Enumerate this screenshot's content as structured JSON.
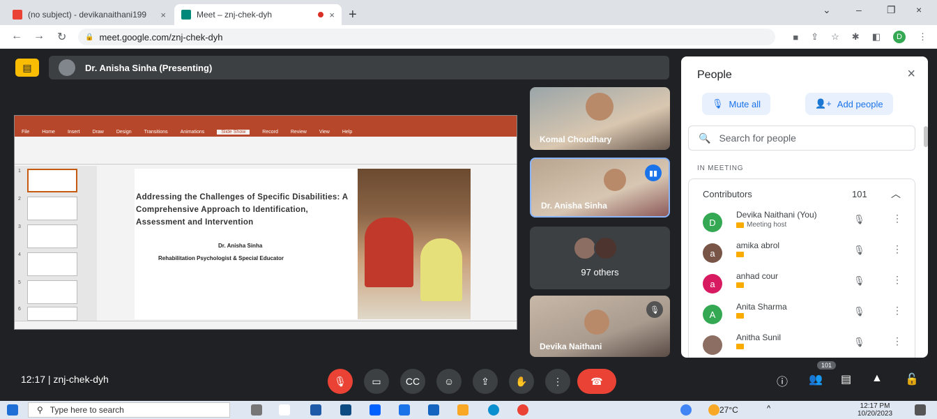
{
  "browser": {
    "tabs": [
      {
        "title": "(no subject) - devikanaithani199",
        "close": "×"
      },
      {
        "title": "Meet – znj-chek-dyh",
        "close": "×"
      }
    ],
    "new_tab": "+",
    "window_controls": {
      "chevron": "⌄",
      "minimize": "–",
      "restore": "❐",
      "close": "×"
    },
    "url": "meet.google.com/znj-chek-dyh",
    "profile_letter": "D",
    "accent": "#1a73e8"
  },
  "meet": {
    "presenter_label": "Dr. Anisha Sinha (Presenting)",
    "slide": {
      "heading": "Addressing the Challenges of Specific Disabilities: A Comprehensive Approach to Identification, Assessment and Intervention",
      "author": "Dr. Anisha Sinha",
      "role": "Rehabilitation Psychologist & Special Educator",
      "ppt_tabs": [
        "File",
        "Home",
        "Insert",
        "Draw",
        "Design",
        "Transitions",
        "Animations",
        "Slide Show",
        "Record",
        "Review",
        "View",
        "Help"
      ],
      "thumb_numbers": [
        "1",
        "2",
        "3",
        "4",
        "5",
        "6"
      ]
    },
    "tiles": [
      {
        "name": "Komal Choudhary"
      },
      {
        "name": "Dr. Anisha Sinha"
      },
      {
        "name": "97 others"
      },
      {
        "name": "Devika Naithani"
      }
    ],
    "meeting_code": "12:17  |  znj-chek-dyh",
    "people_count_badge": "101"
  },
  "people_panel": {
    "title": "People",
    "close_icon": "×",
    "mute_all": "Mute all",
    "add_people": "Add people",
    "search_placeholder": "Search for people",
    "in_meeting": "IN MEETING",
    "contributors_label": "Contributors",
    "contributors_count": "101",
    "participants": [
      {
        "name": "Devika Naithani (You)",
        "sub": "Meeting host",
        "initial": "D",
        "color": "#34a853"
      },
      {
        "name": "amika abrol",
        "sub": "",
        "initial": "a",
        "color": "#795548"
      },
      {
        "name": "anhad cour",
        "sub": "",
        "initial": "a",
        "color": "#d81b60"
      },
      {
        "name": "Anita Sharma",
        "sub": "",
        "initial": "A",
        "color": "#34a853"
      },
      {
        "name": "Anitha Sunil",
        "sub": "",
        "initial": "",
        "color": "#8d6e63"
      }
    ]
  },
  "taskbar": {
    "search_placeholder": "Type here to search",
    "weather": "27°C",
    "time": "12:17 PM",
    "date": "10/20/2023"
  }
}
